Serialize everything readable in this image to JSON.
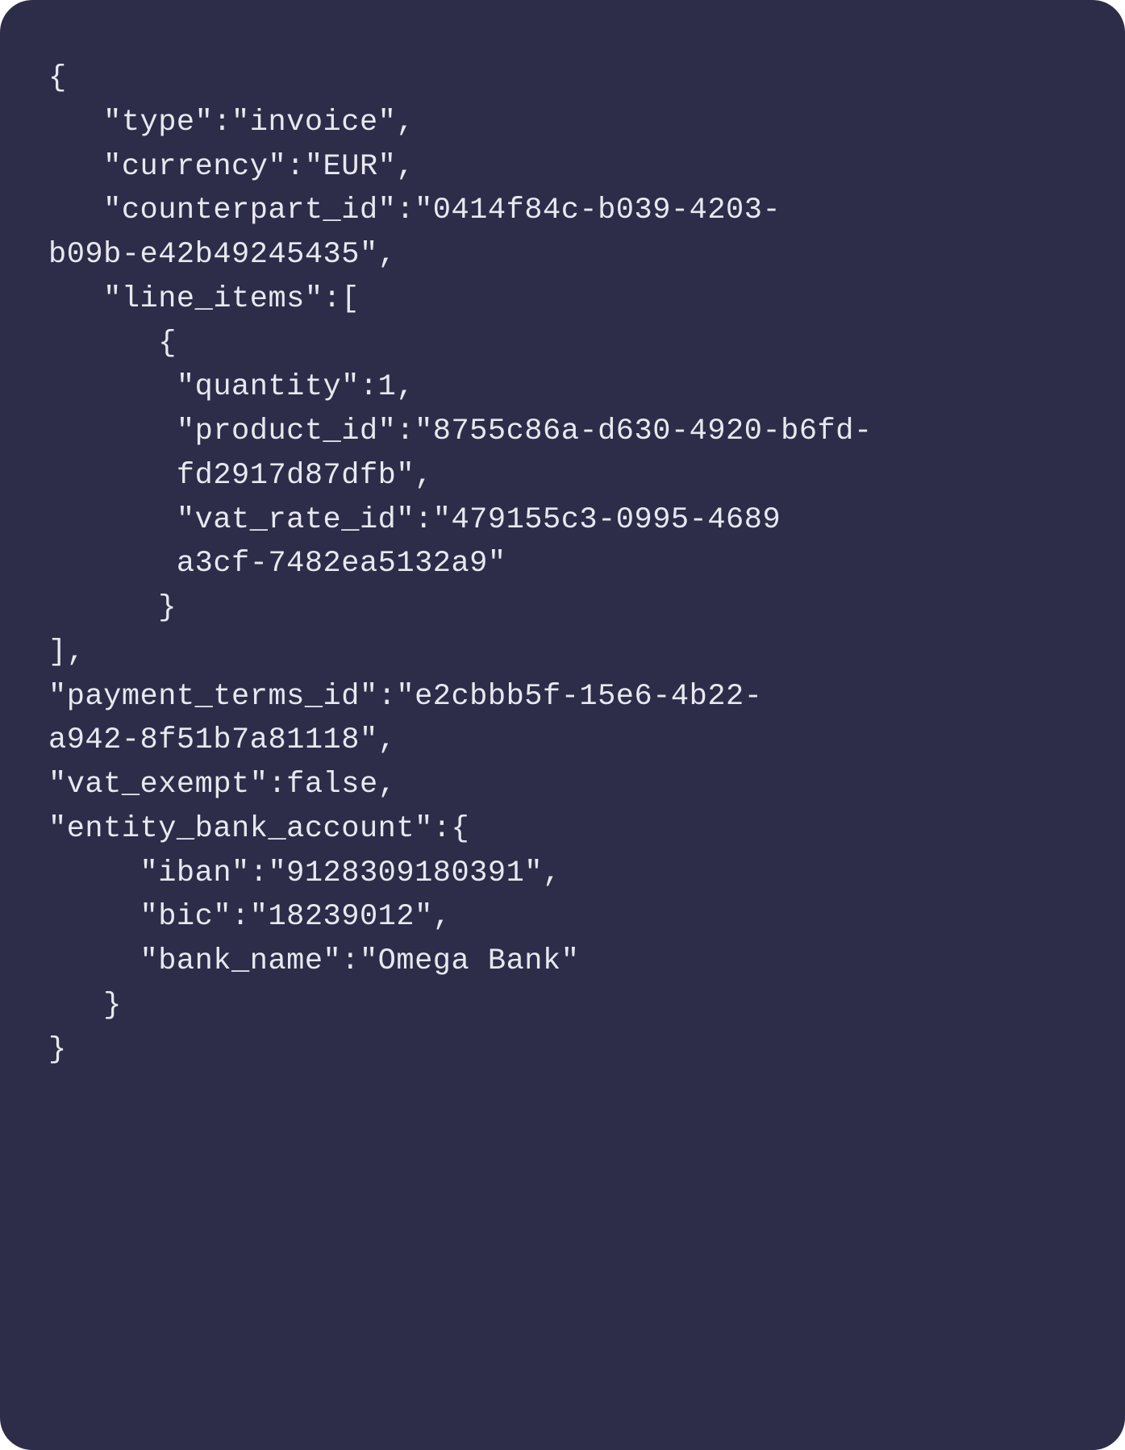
{
  "code": {
    "line1": "{",
    "line2": "   \"type\":\"invoice\",",
    "line3": "   \"currency\":\"EUR\",",
    "line4": "   \"counterpart_id\":\"0414f84c-b039-4203-",
    "line5": "b09b-e42b49245435\",",
    "line6": "   \"line_items\":[",
    "line7": "      {",
    "line8": "       \"quantity\":1,",
    "line9": "       \"product_id\":\"8755c86a-d630-4920-b6fd-",
    "line10": "       fd2917d87dfb\",",
    "line11": "       \"vat_rate_id\":\"479155c3-0995-4689",
    "line12": "       a3cf-7482ea5132a9\"",
    "line13": "      }",
    "line14": "],",
    "line15": "\"payment_terms_id\":\"e2cbbb5f-15e6-4b22-",
    "line16": "a942-8f51b7a81118\",",
    "line17": "\"vat_exempt\":false,",
    "line18": "\"entity_bank_account\":{",
    "line19": "     \"iban\":\"9128309180391\",",
    "line20": "     \"bic\":\"18239012\",",
    "line21": "     \"bank_name\":\"Omega Bank\"",
    "line22": "   }",
    "line23": "}"
  },
  "json_payload": {
    "type": "invoice",
    "currency": "EUR",
    "counterpart_id": "0414f84c-b039-4203-b09b-e42b49245435",
    "line_items": [
      {
        "quantity": 1,
        "product_id": "8755c86a-d630-4920-b6fd-fd2917d87dfb",
        "vat_rate_id": "479155c3-0995-4689 a3cf-7482ea5132a9"
      }
    ],
    "payment_terms_id": "e2cbbb5f-15e6-4b22-a942-8f51b7a81118",
    "vat_exempt": false,
    "entity_bank_account": {
      "iban": "9128309180391",
      "bic": "18239012",
      "bank_name": "Omega Bank"
    }
  },
  "colors": {
    "background": "#2d2d4a",
    "text": "#e8e8f0"
  }
}
